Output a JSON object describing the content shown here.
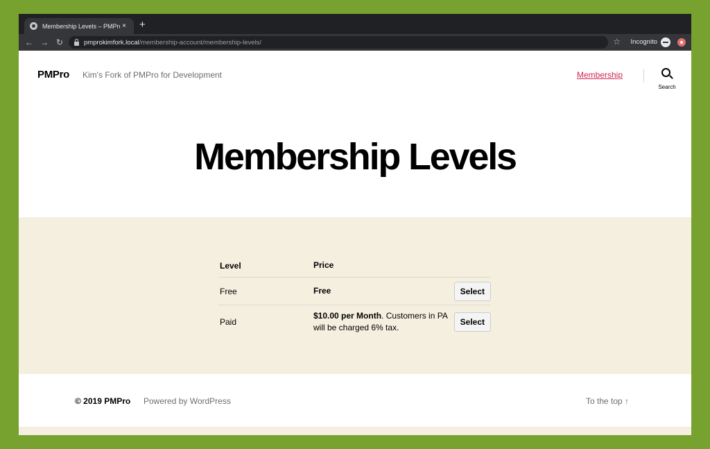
{
  "browser": {
    "tab_title": "Membership Levels – PMPro",
    "tab_close": "×",
    "new_tab": "+",
    "back": "←",
    "forward": "→",
    "reload": "↻",
    "url_host": "pmprokimfork.local",
    "url_path": "/membership-account/membership-levels/",
    "bookmark": "☆",
    "incognito_label": "Incognito"
  },
  "site": {
    "logo": "PMPro",
    "tagline": "Kim's Fork of PMPro for Development",
    "nav_membership": "Membership",
    "search_label": "Search"
  },
  "page": {
    "title": "Membership Levels"
  },
  "levels_table": {
    "headers": [
      "Level",
      "Price"
    ],
    "rows": [
      {
        "level": "Free",
        "price_bold": "Free",
        "price_rest": "",
        "button": "Select"
      },
      {
        "level": "Paid",
        "price_bold": "$10.00 per Month",
        "price_rest": ". Customers in PA will be charged 6% tax.",
        "button": "Select"
      }
    ]
  },
  "footer": {
    "copyright": "© 2019 PMPro",
    "powered": "Powered by WordPress",
    "to_top": "To the top ↑"
  },
  "colors": {
    "accent": "#cd2653",
    "content_bg": "#f5efe0",
    "frame_bg": "#78a22f"
  }
}
